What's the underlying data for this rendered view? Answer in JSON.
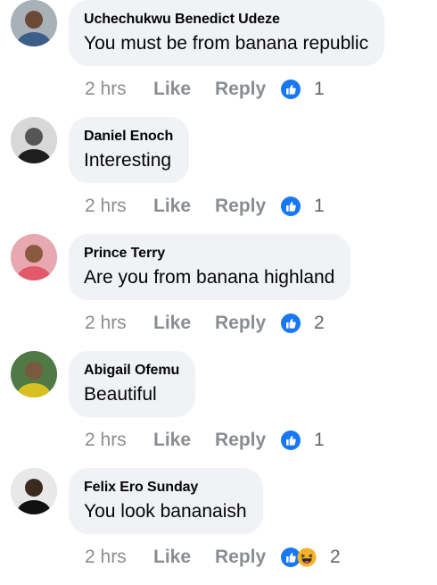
{
  "comments": [
    {
      "author": "Uchechukwu Benedict Udeze",
      "text": "You must be from banana republic",
      "time": "2 hrs",
      "like_label": "Like",
      "reply_label": "Reply",
      "reactions": [
        "like"
      ],
      "reaction_count": "1",
      "avatar_colors": {
        "bg": "#a8b0b8",
        "skin": "#6a4a36",
        "clothes": "#3c5f8a"
      }
    },
    {
      "author": "Daniel Enoch",
      "text": "Interesting",
      "time": "2 hrs",
      "like_label": "Like",
      "reply_label": "Reply",
      "reactions": [
        "like"
      ],
      "reaction_count": "1",
      "avatar_colors": {
        "bg": "#d8d8d8",
        "skin": "#555555",
        "clothes": "#1e1e1e"
      }
    },
    {
      "author": "Prince Terry",
      "text": "Are you from banana highland",
      "time": "2 hrs",
      "like_label": "Like",
      "reply_label": "Reply",
      "reactions": [
        "like"
      ],
      "reaction_count": "2",
      "avatar_colors": {
        "bg": "#e8a8b0",
        "skin": "#8a5a40",
        "clothes": "#e25a6a"
      }
    },
    {
      "author": "Abigail Ofemu",
      "text": "Beautiful",
      "time": "2 hrs",
      "like_label": "Like",
      "reply_label": "Reply",
      "reactions": [
        "like"
      ],
      "reaction_count": "1",
      "avatar_colors": {
        "bg": "#4f7a46",
        "skin": "#7a5a3e",
        "clothes": "#d8c020"
      }
    },
    {
      "author": "Felix Ero Sunday",
      "text": "You look bananaish",
      "time": "2 hrs",
      "like_label": "Like",
      "reply_label": "Reply",
      "reactions": [
        "like",
        "haha"
      ],
      "reaction_count": "2",
      "avatar_colors": {
        "bg": "#e8e8e8",
        "skin": "#3a2a20",
        "clothes": "#111111"
      }
    }
  ],
  "icons": {
    "like": "thumbs-up-reaction-icon",
    "haha": "haha-reaction-icon"
  },
  "colors": {
    "like_blue": "#1877f2",
    "haha_yellow": "#f7b125",
    "bubble": "#f0f2f5",
    "meta_text": "#8a8d91"
  }
}
